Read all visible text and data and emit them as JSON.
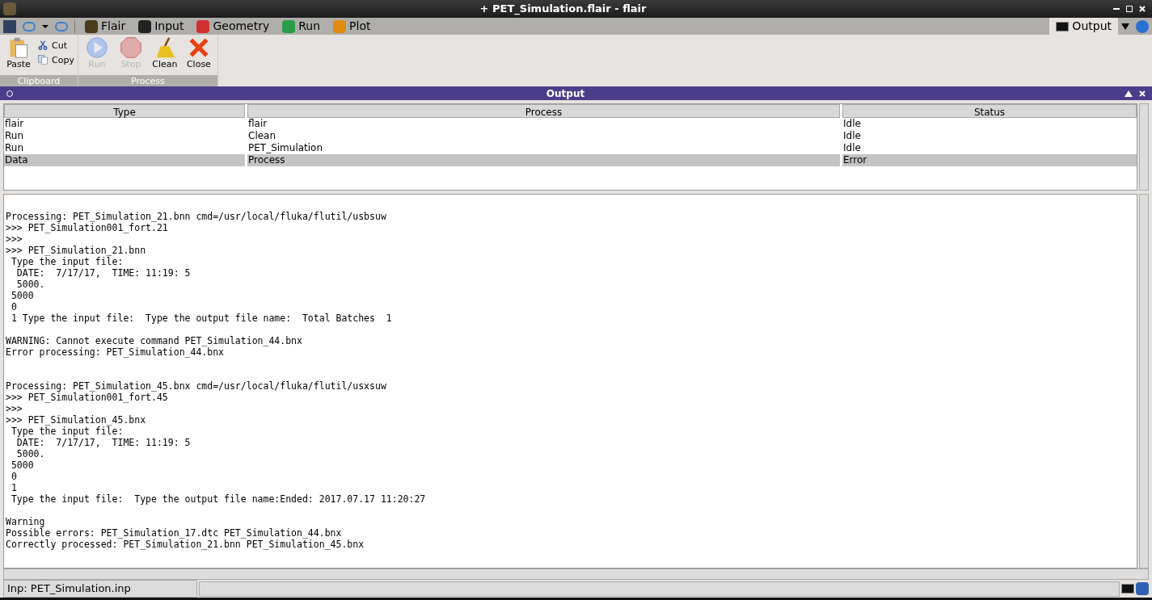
{
  "window": {
    "title": "+ PET_Simulation.flair - flair"
  },
  "tabs": [
    {
      "label": "Flair",
      "selected": false
    },
    {
      "label": "Input",
      "selected": false
    },
    {
      "label": "Geometry",
      "selected": false
    },
    {
      "label": "Run",
      "selected": false
    },
    {
      "label": "Plot",
      "selected": false
    }
  ],
  "right_tab": {
    "label": "Output",
    "selected": true
  },
  "ribbon": {
    "groups": [
      {
        "title": "Clipboard",
        "buttons": [
          {
            "kind": "paste",
            "label": "Paste",
            "disabled": false
          },
          {
            "kind": "cut",
            "label": "Cut",
            "disabled": false
          },
          {
            "kind": "copy",
            "label": "Copy",
            "disabled": false
          }
        ]
      },
      {
        "title": "Process",
        "buttons": [
          {
            "kind": "run",
            "label": "Run",
            "disabled": true
          },
          {
            "kind": "stop",
            "label": "Stop",
            "disabled": true
          },
          {
            "kind": "clean",
            "label": "Clean",
            "disabled": false
          },
          {
            "kind": "close",
            "label": "Close",
            "disabled": false
          }
        ]
      }
    ]
  },
  "panel": {
    "title": "Output"
  },
  "table": {
    "columns": [
      "Type",
      "Process",
      "Status"
    ],
    "rows": [
      {
        "cells": [
          "flair",
          "flair",
          "Idle"
        ],
        "selected": false
      },
      {
        "cells": [
          "Run",
          "Clean",
          "Idle"
        ],
        "selected": false
      },
      {
        "cells": [
          "Run",
          "PET_Simulation",
          "Idle"
        ],
        "selected": false
      },
      {
        "cells": [
          "Data",
          "Process",
          "Error"
        ],
        "selected": true
      }
    ]
  },
  "log": [
    {
      "kind": "blank"
    },
    {
      "kind": "line",
      "text": "Processing: PET_Simulation_21.bnn cmd=/usr/local/fluka/flutil/usbsuw"
    },
    {
      "kind": "line",
      "text": ">>> PET_Simulation001_fort.21"
    },
    {
      "kind": "line",
      "text": ">>>"
    },
    {
      "kind": "line",
      "text": ">>> PET_Simulation_21.bnn"
    },
    {
      "kind": "line",
      "text": " Type the input file:"
    },
    {
      "kind": "line",
      "text": "  DATE:  7/17/17,  TIME: 11:19: 5"
    },
    {
      "kind": "line",
      "text": "  5000."
    },
    {
      "kind": "line",
      "text": " 5000"
    },
    {
      "kind": "line",
      "text": " 0"
    },
    {
      "kind": "line",
      "text": " 1 Type the input file:  Type the output file name:  Total Batches  1"
    },
    {
      "kind": "blank"
    },
    {
      "kind": "line",
      "text": "WARNING: Cannot execute command PET_Simulation_44.bnx"
    },
    {
      "kind": "line",
      "text": "Error processing: PET_Simulation_44.bnx"
    },
    {
      "kind": "blank"
    },
    {
      "kind": "blank"
    },
    {
      "kind": "line",
      "text": "Processing: PET_Simulation_45.bnx cmd=/usr/local/fluka/flutil/usxsuw"
    },
    {
      "kind": "line",
      "text": ">>> PET_Simulation001_fort.45"
    },
    {
      "kind": "line",
      "text": ">>>"
    },
    {
      "kind": "line",
      "text": ">>> PET_Simulation_45.bnx"
    },
    {
      "kind": "line",
      "text": " Type the input file:"
    },
    {
      "kind": "line",
      "text": "  DATE:  7/17/17,  TIME: 11:19: 5"
    },
    {
      "kind": "line",
      "text": "  5000."
    },
    {
      "kind": "line",
      "text": " 5000"
    },
    {
      "kind": "line",
      "text": " 0"
    },
    {
      "kind": "line",
      "text": " 1"
    },
    {
      "kind": "line",
      "text": " Type the input file:  Type the output file name:Ended: 2017.07.17 11:20:27"
    },
    {
      "kind": "blank"
    },
    {
      "kind": "line",
      "text": "Warning"
    },
    {
      "kind": "line",
      "text": "Possible errors: PET_Simulation_17.dtc PET_Simulation_44.bnx"
    },
    {
      "kind": "line",
      "text": "Correctly processed: PET_Simulation_21.bnn PET_Simulation_45.bnx"
    }
  ],
  "status_bar": {
    "text": "Inp: PET_Simulation.inp"
  }
}
